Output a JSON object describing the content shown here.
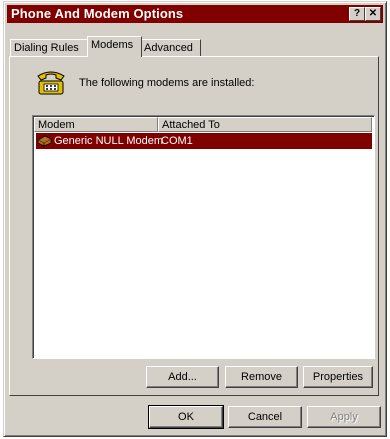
{
  "window": {
    "title": "Phone And Modem Options",
    "help_glyph": "?",
    "close_glyph": "✕"
  },
  "tabs": [
    {
      "label": "Dialing Rules",
      "active": false
    },
    {
      "label": "Modems",
      "active": true
    },
    {
      "label": "Advanced",
      "active": false
    }
  ],
  "modems_tab": {
    "intro": "The following modems are installed:",
    "columns": [
      "Modem",
      "Attached To"
    ],
    "rows": [
      {
        "modem": "Generic NULL Modem",
        "attached_to": "COM1",
        "selected": true
      }
    ],
    "buttons": {
      "add": "Add...",
      "remove": "Remove",
      "properties": "Properties"
    }
  },
  "dialog_buttons": {
    "ok": "OK",
    "cancel": "Cancel",
    "apply": "Apply"
  },
  "colors": {
    "titlebar": "#800000",
    "selection": "#800000",
    "face": "#d4d0c8"
  },
  "icons": {
    "header": "telephone-icon",
    "row": "modem-icon"
  }
}
